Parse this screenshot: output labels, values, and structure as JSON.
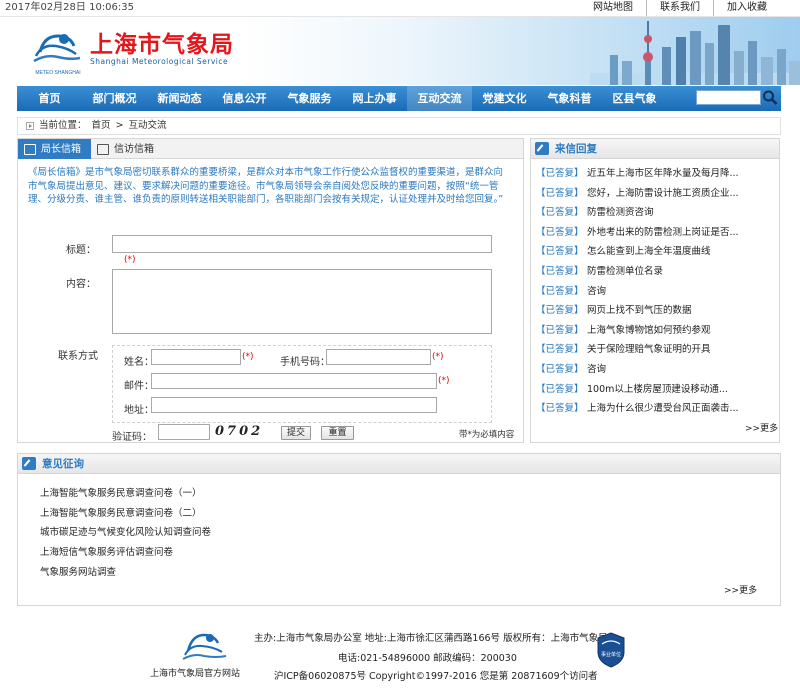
{
  "topbar": {
    "datetime": "2017年02月28日 10:06:35",
    "links": [
      "网站地图",
      "联系我们",
      "加入收藏"
    ]
  },
  "banner": {
    "title": "上海市气象局",
    "subtitle": "Shanghai Meteorological Service",
    "logo_text": "METEO SHANGHAI"
  },
  "nav": {
    "items": [
      "首页",
      "部门概况",
      "新闻动态",
      "信息公开",
      "气象服务",
      "网上办事",
      "互动交流",
      "党建文化",
      "气象科普",
      "区县气象"
    ],
    "active": "互动交流",
    "search_placeholder": ""
  },
  "breadcrumb": {
    "prefix": "当前位置：",
    "home": "首页",
    "current": "互动交流"
  },
  "mailbox": {
    "tab_director": "局长信箱",
    "tab_petition": "信访信箱",
    "intro": "《局长信箱》是市气象局密切联系群众的重要桥梁，是群众对本市气象工作行使公众监督权的重要渠道，是群众向市气象局提出意见、建议、要求解决问题的重要途径。市气象局领导会亲自阅处您反映的重要问题，按照“统一管理、分级分责、谁主管、谁负责的原则转送相关职能部门，各职能部门会按有关规定，认证处理并及时给您回复。”",
    "title_label": "标题：",
    "content_label": "内容：",
    "required_mark": "(*)",
    "contact_label": "联系方式",
    "name_label": "姓名：",
    "mobile_label": "手机号码：",
    "email_label": "邮件：",
    "address_label": "地址：",
    "captcha_label": "验证码：",
    "captcha_text": "0702",
    "submit": "提交",
    "reset": "重置",
    "required_note": "带*为必填内容"
  },
  "replies": {
    "heading": "来信回复",
    "tag": "【已答复】",
    "items": [
      "近五年上海市区年降水量及每月降...",
      "您好，上海防雷设计施工资质企业...",
      "防雷检测资咨询",
      "外地考出来的防雷检测上岗证是否...",
      "怎么能查到上海全年温度曲线",
      "防雷检测单位名录",
      "咨询",
      "网页上找不到气压的数据",
      "上海气象博物馆如何预约参观",
      "关于保险理赔气象证明的开具",
      "咨询",
      "100m以上楼房屋顶建设移动通...",
      "上海为什么很少遭受台风正面袭击..."
    ],
    "more": ">>更多"
  },
  "survey": {
    "heading": "意见征询",
    "items": [
      "上海智能气象服务民意调查问卷（一）",
      "上海智能气象服务民意调查问卷（二）",
      "城市碳足迹与气候变化风险认知调查问卷",
      "上海短信气象服务评估调查问卷",
      "气象服务网站调查"
    ],
    "more": ">>更多"
  },
  "footer": {
    "site_name": "上海市气象局官方网站",
    "line1": "主办:上海市气象局办公室 地址:上海市徐汇区蒲西路166号 版权所有：上海市气象局",
    "line2": "电话:021-54896000 邮政编码：200030",
    "line3": "沪ICP备06020875号 Copyright©1997-2016 您是第 20871609个访问者",
    "badge_text": "事业单位"
  },
  "colors": {
    "brand_red": "#e3161b",
    "nav_blue": "#1a6bb6",
    "link_blue": "#2a78bf"
  }
}
